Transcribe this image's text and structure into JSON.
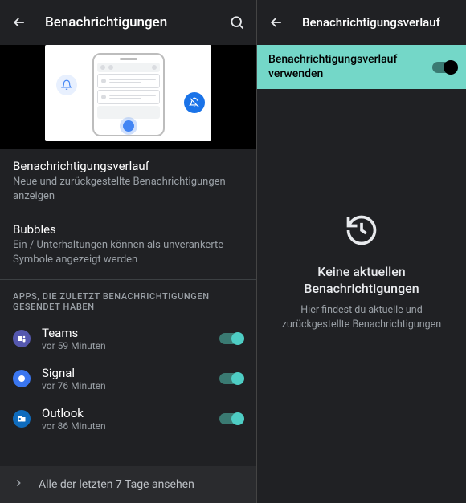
{
  "left": {
    "title": "Benachrichtigungen",
    "items": [
      {
        "primary": "Benachrichtigungsverlauf",
        "secondary": "Neue und zurückgestellte Benachrichtigungen anzeigen"
      },
      {
        "primary": "Bubbles",
        "secondary": "Ein / Unterhaltungen können als unverankerte Symbole angezeigt werden"
      }
    ],
    "section_header": "APPS, DIE ZULETZT BENACHRICHTIGUNGEN GESENDET HABEN",
    "apps": [
      {
        "name": "Teams",
        "sub": "vor 59 Minuten"
      },
      {
        "name": "Signal",
        "sub": "vor 76 Minuten"
      },
      {
        "name": "Outlook",
        "sub": "vor 86 Minuten"
      }
    ],
    "footer": "Alle der letzten 7 Tage ansehen"
  },
  "right": {
    "title": "Benachrichtigungsverlauf",
    "banner": "Benachrichtigungsverlauf verwenden",
    "empty_title": "Keine aktuellen Benachrichtigungen",
    "empty_sub": "Hier findest du aktuelle und zurückgestellte Benachrichtigungen"
  }
}
